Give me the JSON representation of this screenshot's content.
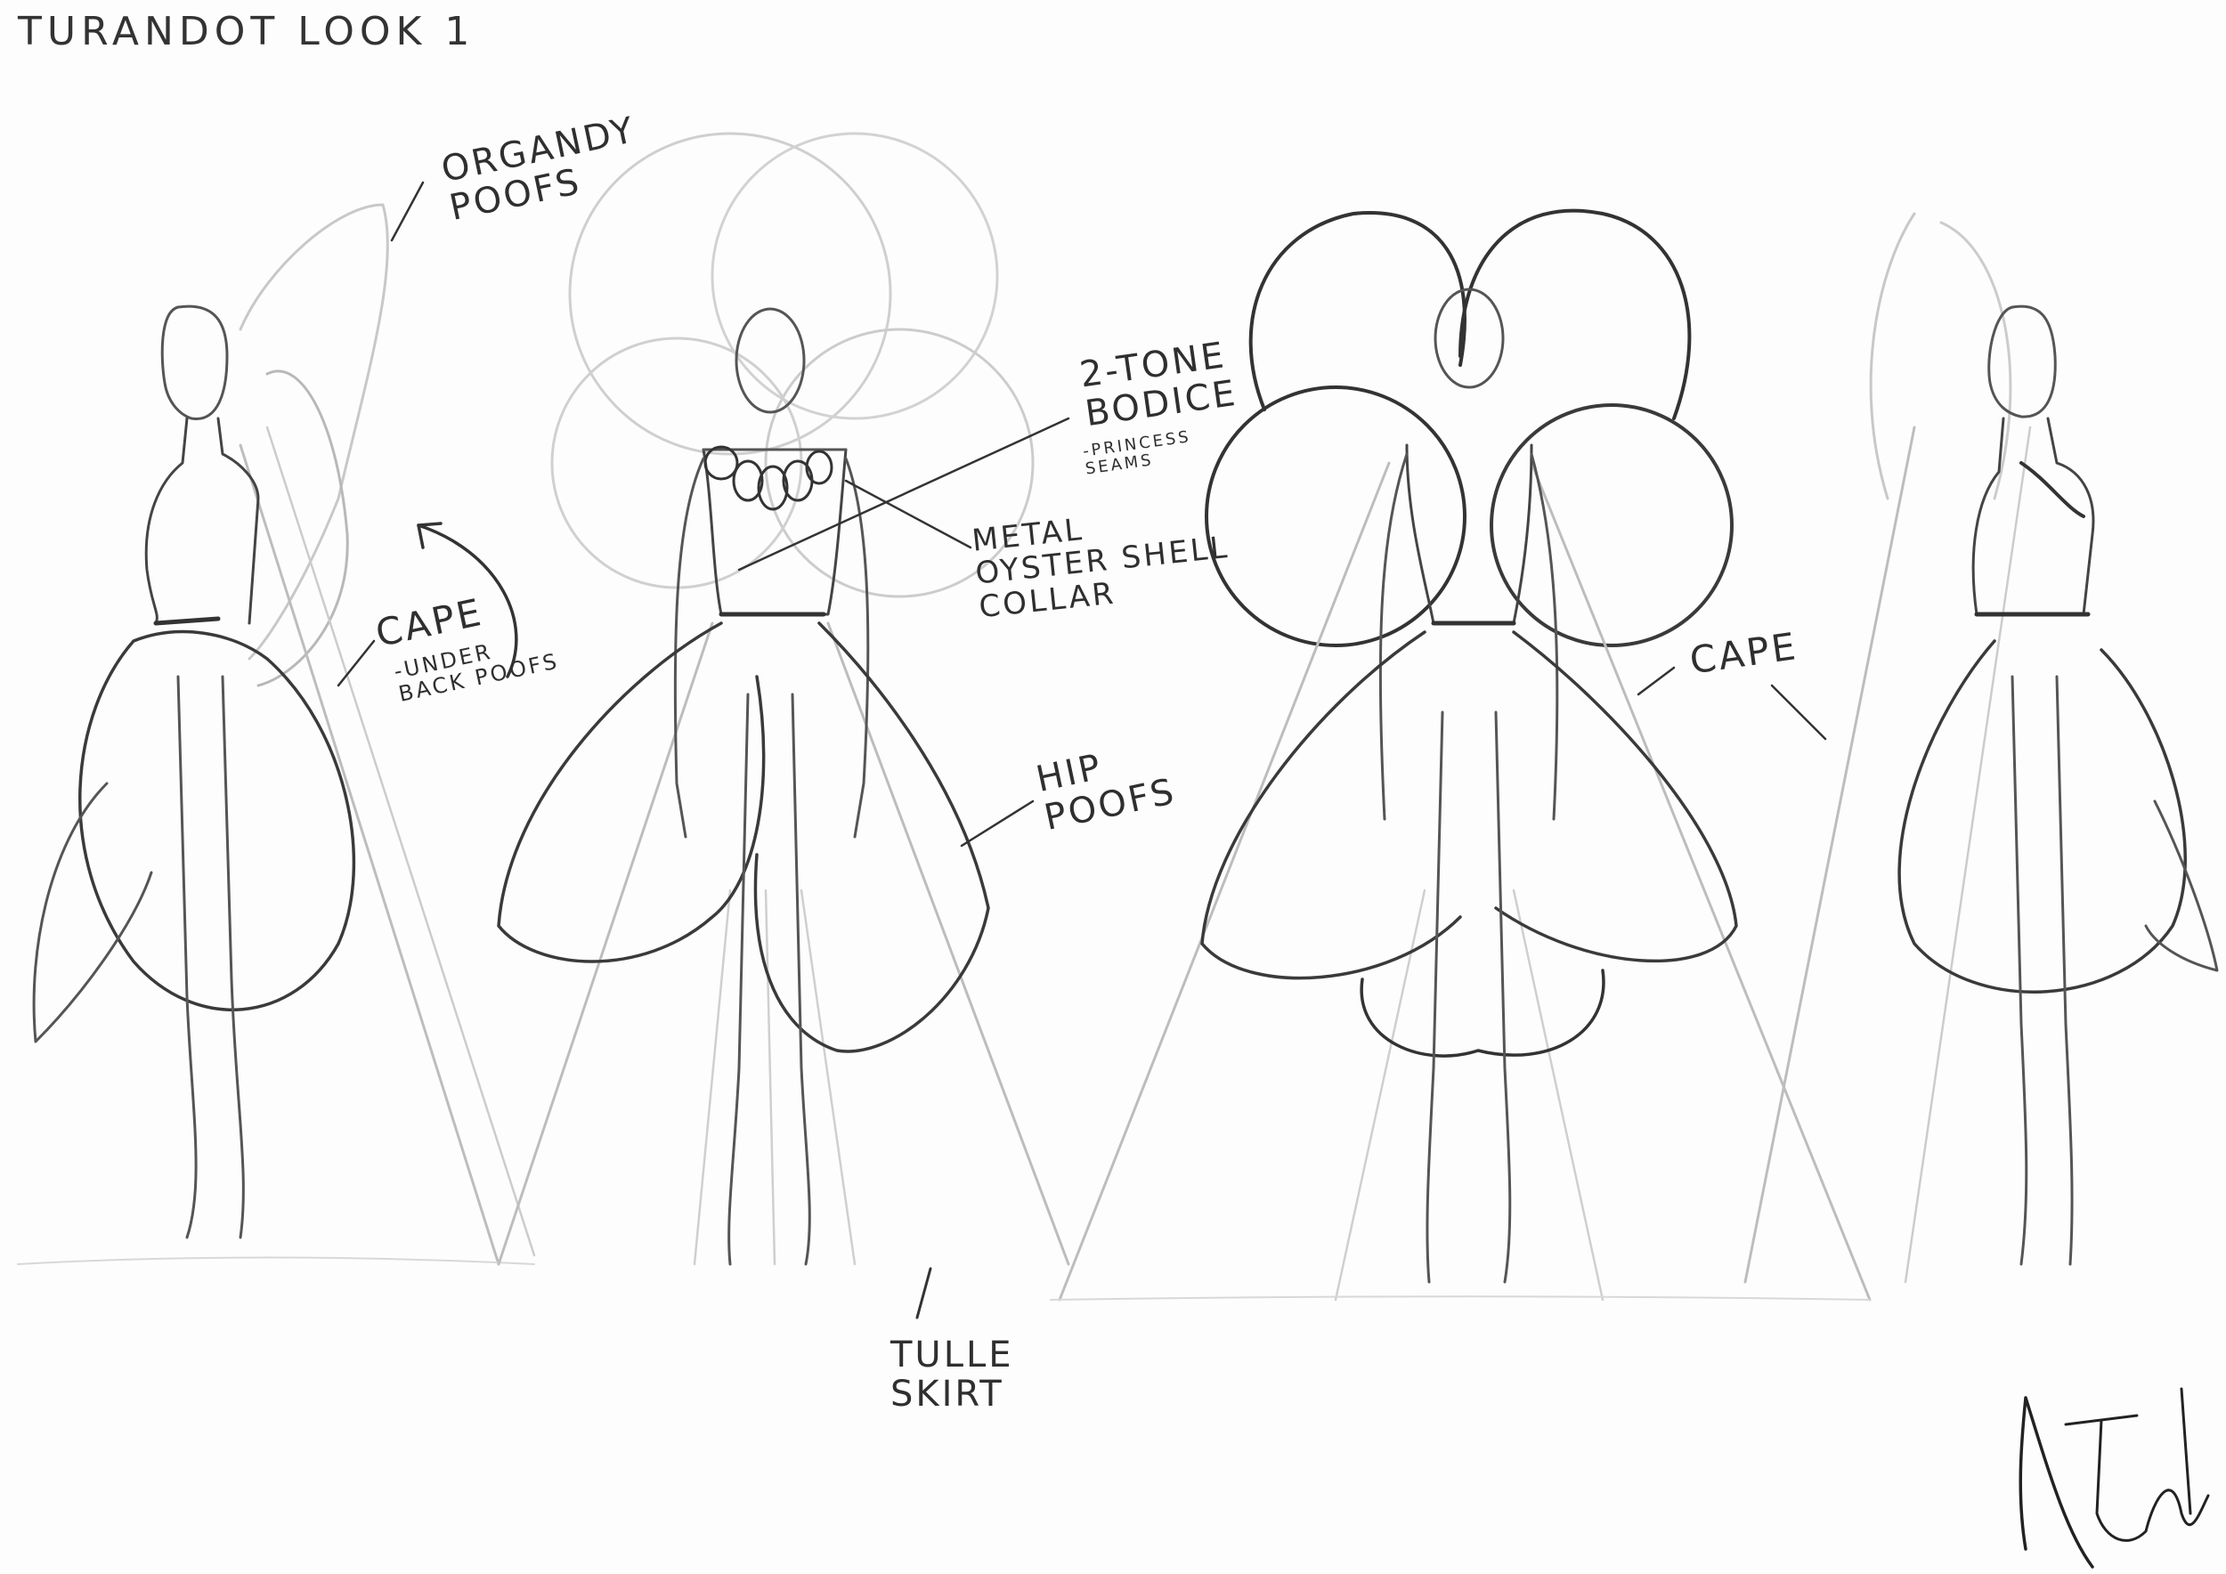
{
  "title": "TURANDOT  LOOK 1",
  "annotations": {
    "organdy_poofs": "ORGANDY\nPOOFS",
    "cape_side": "CAPE",
    "cape_side_sub": "-UNDER\nBACK POOFS",
    "two_tone_bodice": "2-TONE\nBODICE",
    "two_tone_bodice_sub": "-PRINCESS\nSEAMS",
    "metal_collar": "METAL\nOYSTER SHELL\nCOLLAR",
    "hip_poofs": "HIP\nPOOFS",
    "tulle_skirt": "TULLE\nSKIRT",
    "cape_back": "CAPE"
  },
  "colors": {
    "paper": "#fdfdfd",
    "pencil_dark": "#3a3a3a",
    "pencil_light": "#c4c4c4"
  },
  "views": [
    "side-left",
    "front",
    "back",
    "side-right"
  ]
}
